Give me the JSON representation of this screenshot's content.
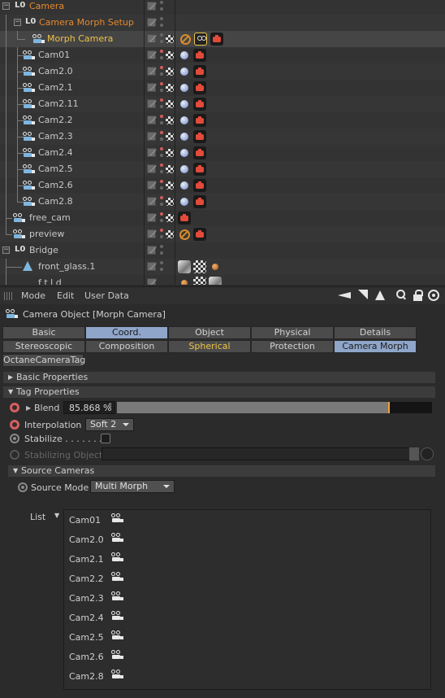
{
  "object_manager": {
    "rows": [
      {
        "name": "Camera",
        "kind": "null",
        "color": "orange"
      },
      {
        "name": "Camera Morph Setup",
        "kind": "null",
        "color": "orange"
      },
      {
        "name": "Morph Camera",
        "kind": "camera",
        "color": "gold"
      },
      {
        "name": "Cam01",
        "kind": "camera"
      },
      {
        "name": "Cam2.0",
        "kind": "camera"
      },
      {
        "name": "Cam2.1",
        "kind": "camera"
      },
      {
        "name": "Cam2.11",
        "kind": "camera"
      },
      {
        "name": "Cam2.2",
        "kind": "camera"
      },
      {
        "name": "Cam2.3",
        "kind": "camera"
      },
      {
        "name": "Cam2.4",
        "kind": "camera"
      },
      {
        "name": "Cam2.5",
        "kind": "camera"
      },
      {
        "name": "Cam2.6",
        "kind": "camera"
      },
      {
        "name": "Cam2.8",
        "kind": "camera"
      },
      {
        "name": "free_cam",
        "kind": "camera"
      },
      {
        "name": "preview",
        "kind": "camera"
      },
      {
        "name": "Bridge",
        "kind": "null"
      },
      {
        "name": "front_glass.1",
        "kind": "poly"
      },
      {
        "name": "f  t  l  d",
        "kind": "poly"
      }
    ]
  },
  "menubar": {
    "items": [
      "Mode",
      "Edit",
      "User Data"
    ],
    "tools": [
      "back-icon",
      "arrow-icon",
      "up-icon",
      "search-icon",
      "lock-icon",
      "target-icon"
    ]
  },
  "attributes": {
    "title": "Camera Object [Morph Camera]",
    "tabs_row1": [
      "Basic",
      "Coord.",
      "Object",
      "Physical",
      "Details"
    ],
    "tabs_row2": [
      "Stereoscopic",
      "Composition",
      "Spherical",
      "Protection",
      "Camera Morph"
    ],
    "tabs_row3": [
      "OctaneCameraTag"
    ],
    "sections": {
      "basic": "Basic Properties",
      "tag": "Tag Properties",
      "source": "Source Cameras"
    },
    "blend": {
      "label": "Blend",
      "value": "85.868 %",
      "fraction": 0.86
    },
    "interpolation": {
      "label": "Interpolation",
      "value": "Soft 2"
    },
    "stabilize": {
      "label": "Stabilize . . . . . . . .",
      "checked": false
    },
    "stabilizing_object": {
      "label": "Stabilizing Object"
    },
    "source_mode": {
      "label": "Source Mode",
      "value": "Multi Morph"
    },
    "list": {
      "label": "List",
      "items": [
        "Cam01",
        "Cam2.0",
        "Cam2.1",
        "Cam2.2",
        "Cam2.3",
        "Cam2.4",
        "Cam2.5",
        "Cam2.6",
        "Cam2.8"
      ]
    }
  }
}
